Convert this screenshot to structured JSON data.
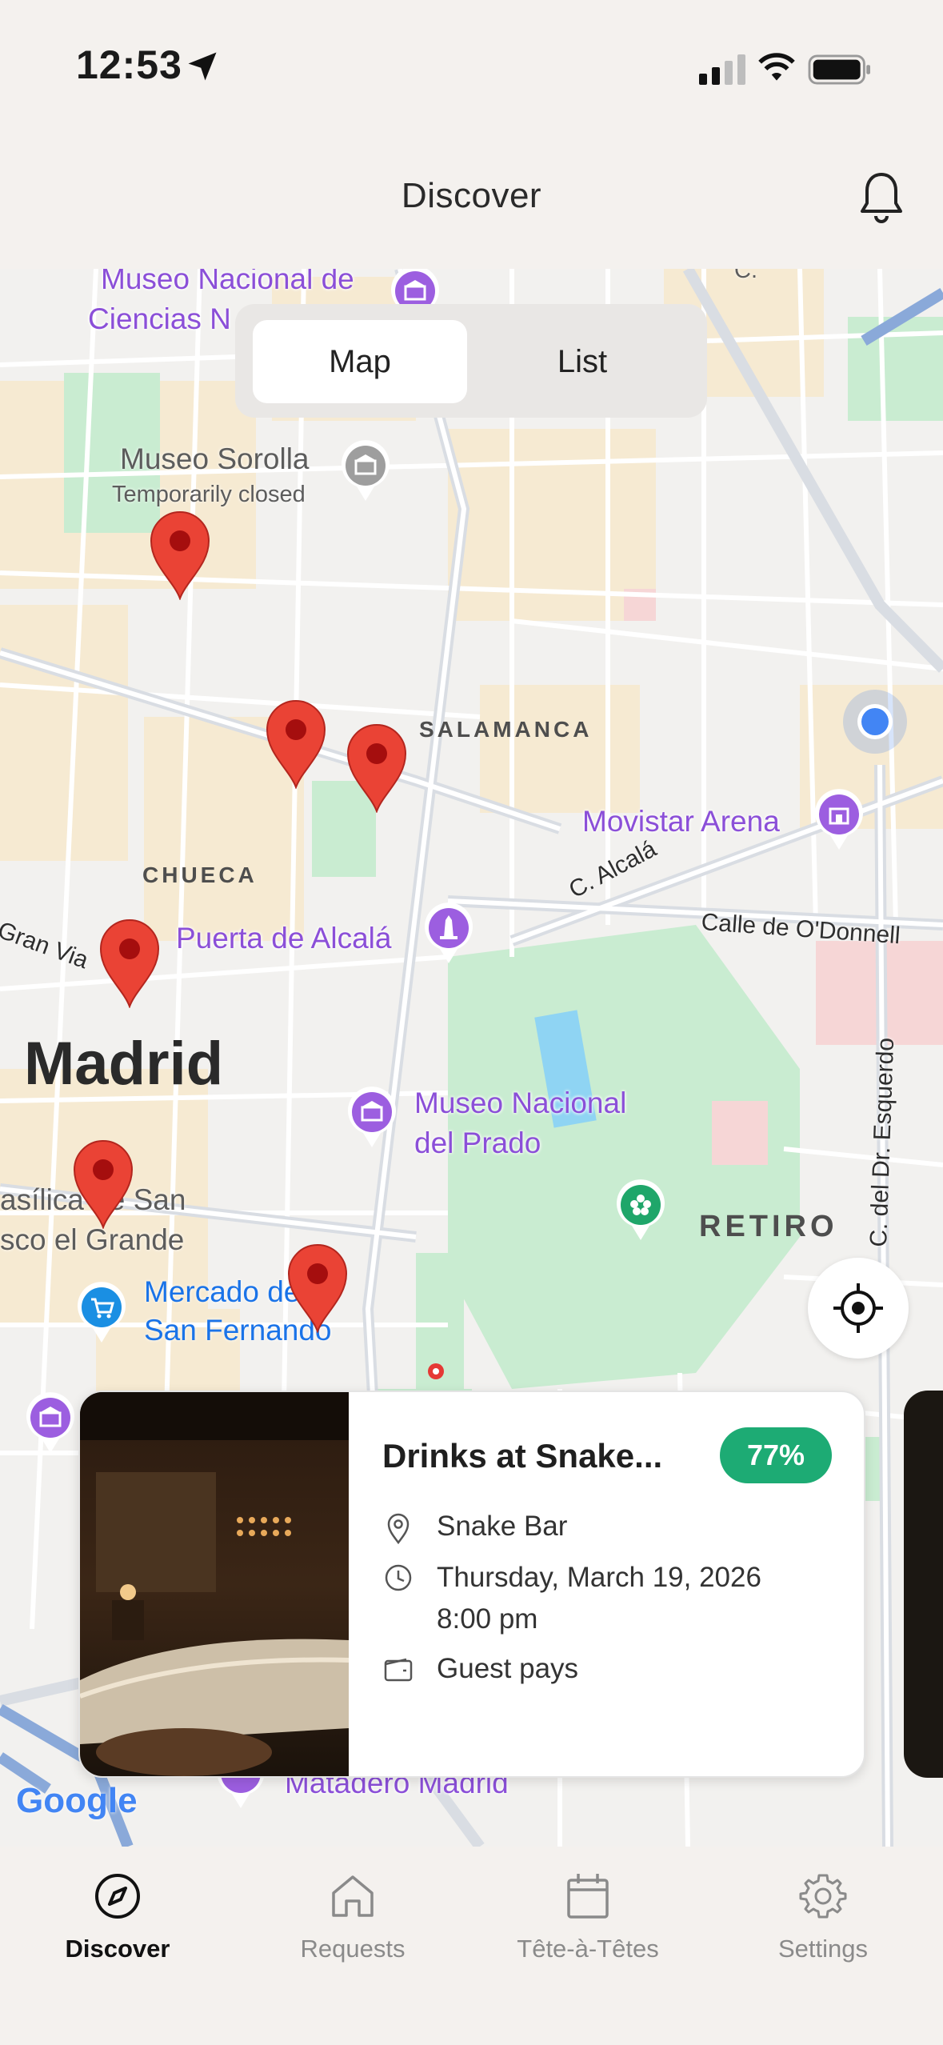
{
  "status_bar": {
    "time": "12:53"
  },
  "header": {
    "title": "Discover"
  },
  "segmented": {
    "map_label": "Map",
    "list_label": "List",
    "selected": "Map"
  },
  "map": {
    "labels": {
      "museo_ciencias_1": "Museo Nacional de",
      "museo_ciencias_2": "Ciencias N",
      "museo_sorolla": "Museo Sorolla",
      "temporarily_closed": "Temporarily closed",
      "salamanca": "SALAMANCA",
      "movistar_arena": "Movistar Arena",
      "chueca": "CHUECA",
      "c_alcala": "C. Alcalá",
      "calle_odonnell": "Calle de O'Donnell",
      "gran_via": "Gran Via",
      "puerta_alcala": "Puerta de Alcalá",
      "madrid": "Madrid",
      "museo_prado_1": "Museo Nacional",
      "museo_prado_2": "del Prado",
      "basilica_1": "asílica de San",
      "basilica_2": "sco el Grande",
      "retiro": "RETIRO",
      "dr_esquerdo": "C. del Dr. Esquerdo",
      "mercado_1": "Mercado de",
      "mercado_2": "San Fernando",
      "matadero": "Matadero Madrid",
      "google": "Google",
      "corner_street": "C."
    }
  },
  "card": {
    "title": "Drinks at Snake...",
    "match": "77%",
    "venue": "Snake Bar",
    "date": "Thursday, March 19, 2026",
    "time": "8:00 pm",
    "payment": "Guest pays",
    "colors": {
      "badge": "#1dab74"
    }
  },
  "tabs": [
    {
      "label": "Discover",
      "icon": "compass-icon",
      "active": true
    },
    {
      "label": "Requests",
      "icon": "home-icon",
      "active": false
    },
    {
      "label": "Tête-à-Têtes",
      "icon": "calendar-icon",
      "active": false
    },
    {
      "label": "Settings",
      "icon": "gear-icon",
      "active": false
    }
  ]
}
